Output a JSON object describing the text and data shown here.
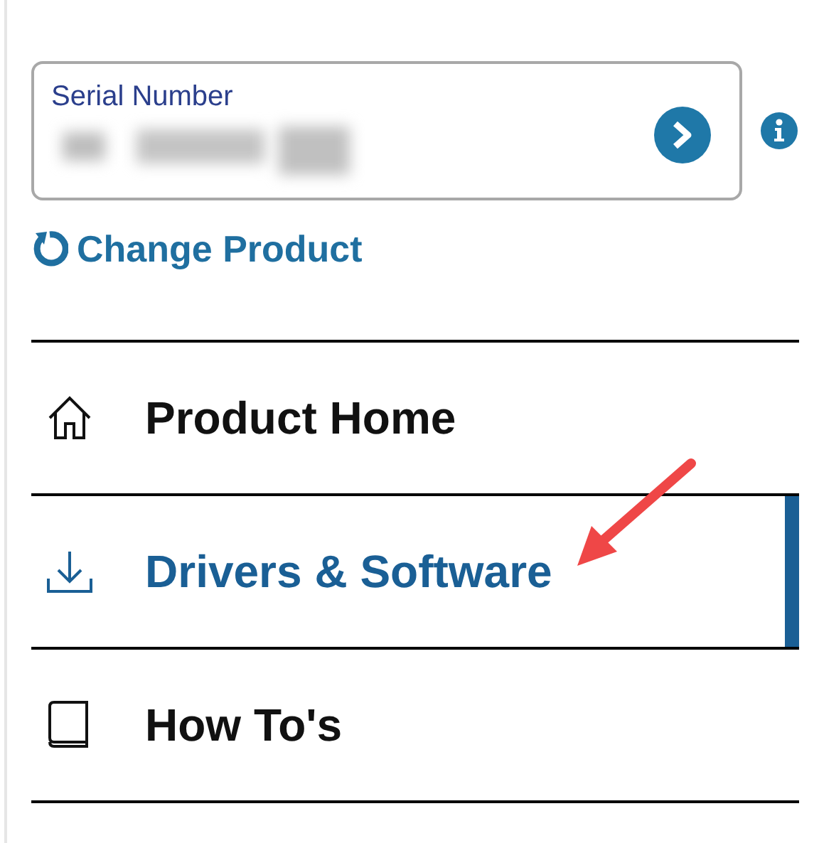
{
  "serial_field": {
    "label": "Serial Number"
  },
  "change_product": "Change Product",
  "nav": [
    {
      "label": "Product Home",
      "selected": false
    },
    {
      "label": "Drivers & Software",
      "selected": true
    },
    {
      "label": "How To's",
      "selected": false
    }
  ]
}
